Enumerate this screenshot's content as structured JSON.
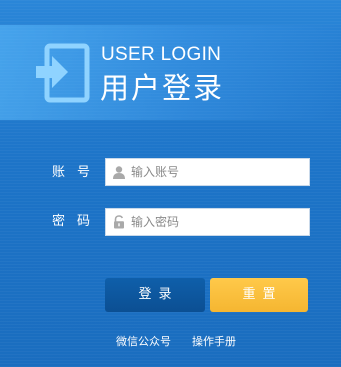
{
  "header": {
    "title_en": "USER LOGIN",
    "title_zh": "用户登录",
    "icon": "login-enter-icon"
  },
  "form": {
    "account": {
      "label": "账号",
      "placeholder": "输入账号",
      "value": "",
      "icon": "user-icon"
    },
    "password": {
      "label": "密码",
      "placeholder": "输入密码",
      "value": "",
      "icon": "lock-icon"
    }
  },
  "buttons": {
    "login": "登录",
    "reset": "重置"
  },
  "footer": {
    "links": [
      "微信公众号",
      "操作手册"
    ]
  },
  "colors": {
    "background": "#1d74c8",
    "login_button": "#0d5aa3",
    "reset_button": "#f8bf3c",
    "text": "#ffffff"
  }
}
